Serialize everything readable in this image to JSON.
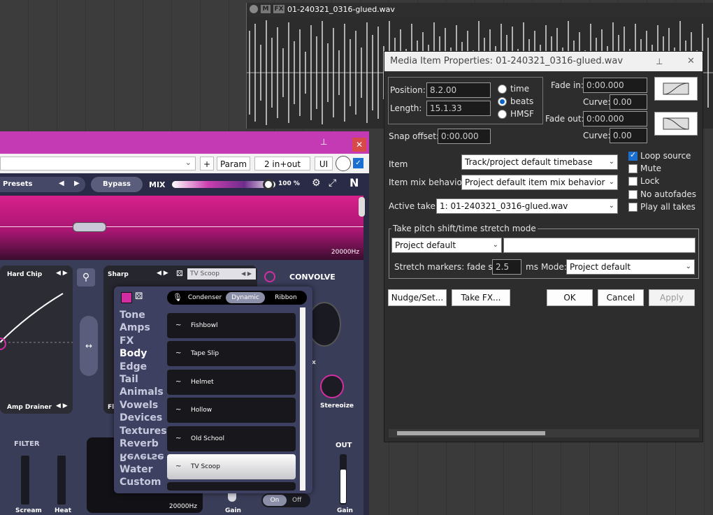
{
  "daw": {
    "media_item": {
      "name": "01-240321_0316-glued.wav",
      "badge_m": "M",
      "badge_fx": "FX"
    }
  },
  "plugin": {
    "toolbar": {
      "add": "+",
      "param": "Param",
      "io": "2 in+out",
      "ui": "UI"
    },
    "header": {
      "presets": "Presets",
      "bypass": "Bypass",
      "mix_label": "MIX",
      "mix_value": "100 %",
      "mix_level": 1.0
    },
    "spectrum": {
      "freq_label": "20000Hz"
    },
    "body": {
      "hard_chip": "Hard Chip",
      "amp_drainer": "Amp Drainer",
      "sharp": "Sharp",
      "tv_scoop_selector": "TV Scoop",
      "convolve": "CONVOLVE",
      "stereoize": "Stereoize",
      "filter": "FILTER",
      "scream": "Scream",
      "heat": "Heat",
      "freq_label_bottom": "20000Hz",
      "gain_a": "Gain",
      "gain_b": "Gain",
      "on": "On",
      "off": "Off",
      "out": "OUT",
      "fl": "Fl",
      "x": "x"
    },
    "browser": {
      "mic_tabs": [
        "Condenser",
        "Dynamic",
        "Ribbon"
      ],
      "active_tab": "Dynamic",
      "categories": [
        "Tone",
        "Amps",
        "FX",
        "Body",
        "Edge",
        "Tail",
        "Animals",
        "Vowels",
        "Devices",
        "Textures",
        "Reverb",
        "Reverse",
        "Water",
        "Custom"
      ],
      "active_category": "Body",
      "presets": [
        "Fishbowl",
        "Tape Slip",
        "Helmet",
        "Hollow",
        "Old School",
        "TV Scoop"
      ],
      "active_preset": "TV Scoop"
    }
  },
  "dialog": {
    "title": "Media Item Properties:  01-240321_0316-glued.wav",
    "position_label": "Position:",
    "position_value": "8.2.00",
    "length_label": "Length:",
    "length_value": "15.1.33",
    "timebase_options": [
      "time",
      "beats",
      "HMSF"
    ],
    "timebase_selected": "beats",
    "snap_offset_label": "Snap offset:",
    "snap_offset_value": "0:00.000",
    "fade_in_label": "Fade in:",
    "fade_in_value": "0:00.000",
    "fade_in_curve_label": "Curve:",
    "fade_in_curve_value": "0.00",
    "fade_out_label": "Fade out:",
    "fade_out_value": "0:00.000",
    "fade_out_curve_label": "Curve:",
    "fade_out_curve_value": "0.00",
    "item_label": "Item",
    "item_value": "Track/project default timebase",
    "mix_behavior_label": "Item mix behavior:",
    "mix_behavior_value": "Project default item mix behavior",
    "active_take_label": "Active take:",
    "active_take_value": "1: 01-240321_0316-glued.wav",
    "checkboxes": [
      {
        "label": "Loop source",
        "checked": true
      },
      {
        "label": "Mute",
        "checked": false
      },
      {
        "label": "Lock",
        "checked": false
      },
      {
        "label": "No autofades",
        "checked": false
      },
      {
        "label": "Play all takes",
        "checked": false
      }
    ],
    "pitch_group_label": "Take pitch shift/time stretch mode",
    "pitch_mode_value": "Project default",
    "pitch_submode_value": "",
    "stretch_markers_label": "Stretch markers: fade size:",
    "stretch_fade_value": "2.5",
    "stretch_unit": "ms",
    "mode_label": "Mode:",
    "mode_value": "Project default",
    "buttons": {
      "nudge": "Nudge/Set...",
      "take_fx": "Take FX...",
      "ok": "OK",
      "cancel": "Cancel",
      "apply": "Apply"
    }
  }
}
